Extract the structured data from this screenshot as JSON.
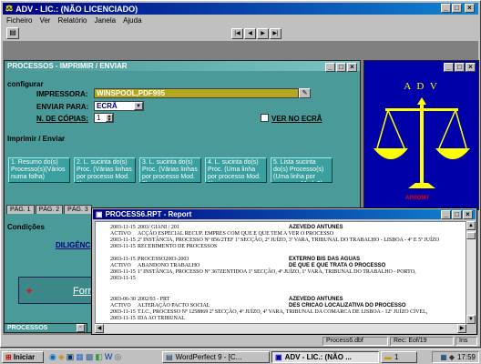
{
  "app": {
    "title": "ADV - LIC.: (NÃO LICENCIADO)",
    "menu": [
      "Ficheiro",
      "Ver",
      "Relatório",
      "Janela",
      "Ajuda"
    ],
    "nav": [
      "|◀",
      "◀",
      "▶",
      "▶|"
    ]
  },
  "print_window": {
    "title": "PROCESSOS - IMPRIMIR / ENVIAR",
    "section_config": "configurar",
    "impressora_label": "IMPRESSORA:",
    "impressora_value": "WINSPOOL,PDF995",
    "enviar_label": "ENVIAR PARA:",
    "enviar_value": "ECRÃ",
    "copias_label": "N. DE CÓPIAS:",
    "copias_value": "1",
    "ver_label": "VER NO ECRÃ",
    "section_print": "Imprimir / Enviar",
    "options": [
      "1. Resumo do(s) Processo(s)(Vários numa folha)",
      "2. L. sucinta do(s) Proc. (Várias linhas por processo Mod. 1)",
      "3. L. sucinta do(s) Proc. (Várias linhas por processo Mod. 2)",
      "4. L. sucinta do(s) Proc. (Uma linha por processo Mod. 1)",
      "5. Lista sucinta do(s) Processo(s)(Uma linha por processo Mod. 2)"
    ],
    "tabs": [
      "PÁG. 1",
      "PÁG. 2",
      "PÁG. 3"
    ],
    "section_cond": "Condições",
    "dilig": "DILIGÊNC",
    "form": "Form"
  },
  "adv_window": {
    "title": "",
    "logo_text": "A D V",
    "badge": "APROMT"
  },
  "report": {
    "title": "PROCESS6.RPT - Report",
    "entries": [
      {
        "date": "2003-11-15",
        "num": "2003/ GIANI / 201",
        "name": "AZEVEDO ANTUNES",
        "status": "ACTIVO",
        "desc": "ACÇÃO ESPECIAL RECUP. EMPRES COM QUE E QUE TEM A VER O PROCESSO",
        "d2": "2003-11-15",
        "detail": "2ª INSTÂNCIA, PROCESSO Nº 856/2TEF 1ª SECÇÃO, 2º JUÍZO, 3ª VARA, TRIBUNAL DO TRABALHO - LISBOA - 4º E 5º JUÍZO",
        "d3": "2003-11-15",
        "note": "RECEBIMENTO DE PROCESSOS"
      },
      {
        "date": "2003-11-15",
        "num": "PROCESSO2003-2003",
        "name": "EXTERNO BIS DAS AGUAS",
        "status": "ACTIVO",
        "desc": "ABANDONO TRABALHO",
        "extra": "DE QUE E QUE TRATA O PROCESSO",
        "d2": "2003-11-15",
        "detail": "1ª INSTÂNCIA, PROCESSO Nº 367ZENTIDOA 1ª SECÇÃO, 4º JUÍZO, 1ª VARA, TRIBUNAL DO TRABALHO - PORTO,",
        "d3": "2003-11-15",
        "note": ""
      },
      {
        "date": "2003-06-30",
        "num": "2002/03 - PRT",
        "name": "AZEVEDO ANTUNES",
        "status": "ACTIVO",
        "desc": "ALTERAÇÃO PACTO SOCIAL",
        "extra": "DES CRICAO LOCALIZATIVA DO PROCESSO",
        "d2": "2003-11-15",
        "detail": "T.I.C., PROCESSO Nº 1258869 2ª SECÇÃO, 4º JUÍZO, 4ª VARA, TRIBUNAL DA COMARCA DE LISBOA - 12º JUÍZO CÍVEL,",
        "d3": "2003-11-15",
        "note": "IDA AO TRIBUNAL"
      }
    ]
  },
  "status": {
    "file": "Process6.dbf",
    "rec": "Rec: Eof/19",
    "ins": "Ins"
  },
  "min_task": "PROCESSOS",
  "taskbar": {
    "start": "Iniciar",
    "tasks": [
      "WordPerfect 9 - [C...",
      "ADV - LIC.: (NÃO ...",
      "1"
    ],
    "clock": "17:59"
  },
  "colors": {
    "title": "#000080",
    "teal": "#4a9a9a",
    "yellow": "#ffff00",
    "desktop": "#808080"
  }
}
